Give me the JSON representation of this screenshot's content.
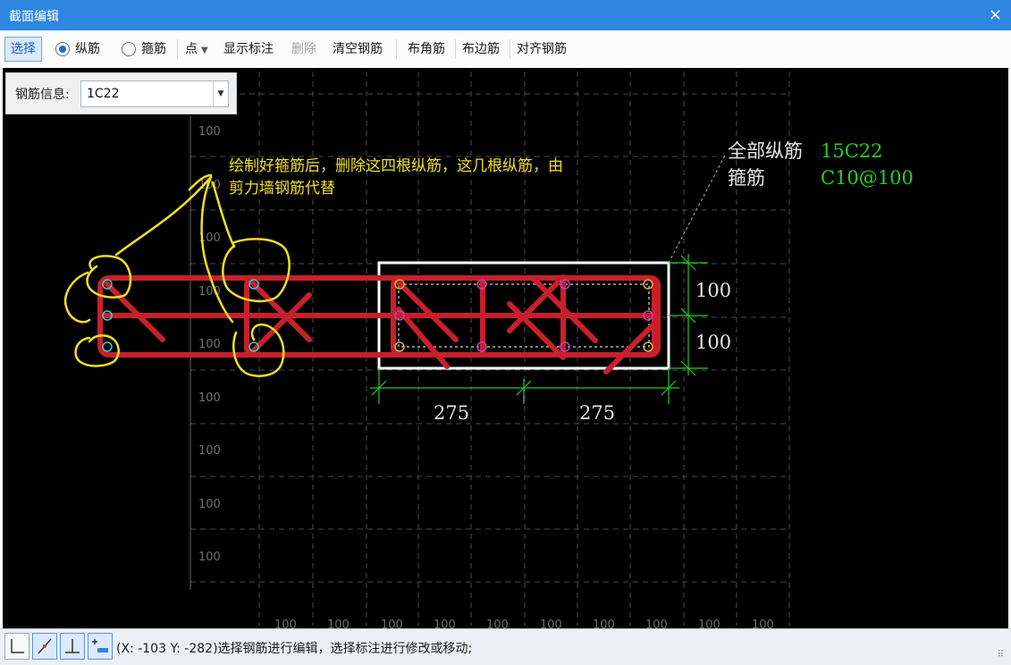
{
  "window": {
    "title": "截面编辑",
    "close_label": "×"
  },
  "toolbar": {
    "select": "选择",
    "longitudinal": "纵筋",
    "stirrup": "箍筋",
    "point": "点",
    "show_dims": "显示标注",
    "delete": "删除",
    "clear_rebar": "清空钢筋",
    "corner_rebar": "布角筋",
    "edge_rebar": "布边筋",
    "align_rebar": "对齐钢筋"
  },
  "rebar_info": {
    "label": "钢筋信息:",
    "value": "1C22"
  },
  "canvas": {
    "grid_labels": [
      "100",
      "100",
      "100",
      "100",
      "100",
      "100",
      "100",
      "100",
      "100"
    ],
    "bottom_grid_labels": [
      "100",
      "100",
      "100",
      "100",
      "100",
      "100",
      "100",
      "100",
      "100",
      "100"
    ],
    "annotation_line1": "绘制好箍筋后，删除这四根纵筋，这几根纵筋，由",
    "annotation_line2": "剪力墙钢筋代替",
    "legend_all_label": "全部纵筋",
    "legend_all_value": "15C22",
    "legend_stirrup_label": "箍筋",
    "legend_stirrup_value": "C10@100",
    "dim_right_top": "100",
    "dim_right_bottom": "100",
    "dim_bottom_left": "275",
    "dim_bottom_right": "275"
  },
  "status": {
    "text": "(X: -103 Y: -282)选择钢筋进行编辑，选择标注进行修改或移动;",
    "grip": "⠿"
  },
  "colors": {
    "accent": "#2f86e0",
    "rebar": "#c8202a",
    "dim": "#22cc22",
    "note": "#f0e020"
  }
}
